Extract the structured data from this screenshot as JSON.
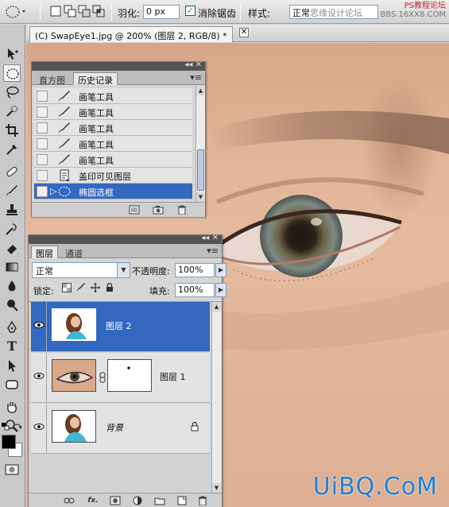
{
  "options_bar": {
    "feather_label": "羽化:",
    "feather_value": "0 px",
    "antialias_checked": "✓",
    "antialias_label": "消除锯齿",
    "style_label": "样式:",
    "style_value": "正常",
    "style_overlay": "思缘设计论坛",
    "watermark_line1": "PS教程论坛",
    "watermark_line2": "BBS.16XX8.COM"
  },
  "document": {
    "tab_title": "(C) SwapEye1.jpg @ 200% (图层 2, RGB/8) *",
    "close_glyph": "✕"
  },
  "history_panel": {
    "tabs": [
      "直方图",
      "历史记录"
    ],
    "menu_glyph": "▾≡",
    "title_controls": "◂◂ ✕",
    "items": [
      {
        "label": "画笔工具",
        "icon": "brush-icon",
        "selected": false
      },
      {
        "label": "画笔工具",
        "icon": "brush-icon",
        "selected": false
      },
      {
        "label": "画笔工具",
        "icon": "brush-icon",
        "selected": false
      },
      {
        "label": "画笔工具",
        "icon": "brush-icon",
        "selected": false
      },
      {
        "label": "画笔工具",
        "icon": "brush-icon",
        "selected": false
      },
      {
        "label": "盖印可见图层",
        "icon": "stamp-visible-icon",
        "selected": false
      },
      {
        "label": "椭圆选框",
        "icon": "elliptical-marquee-icon",
        "selected": true
      }
    ]
  },
  "layers_panel": {
    "tabs": [
      "图层",
      "通道"
    ],
    "menu_glyph": "▾≡",
    "title_controls": "◂◂ ✕",
    "blend_mode": "正常",
    "opacity_label": "不透明度:",
    "opacity_value": "100%",
    "lock_label": "锁定:",
    "fill_label": "填充:",
    "fill_value": "100%",
    "layers": [
      {
        "name": "图层 2",
        "visible": true,
        "selected": true,
        "thumb": "woman-photo"
      },
      {
        "name": "图层 1",
        "visible": true,
        "selected": false,
        "thumb": "eye-photo",
        "has_mask": true
      },
      {
        "name": "背景",
        "visible": true,
        "selected": false,
        "thumb": "woman-photo",
        "locked": true
      }
    ],
    "footer_buttons": [
      "link-icon",
      "fx-icon",
      "mask-icon",
      "adjustment-icon",
      "group-icon",
      "new-layer-icon",
      "trash-icon"
    ],
    "fx_label": "fx."
  },
  "watermark_bottom": "UiBQ.CoM",
  "colors": {
    "selection_blue": "#3368c0",
    "panel_bg": "#d6d6d6",
    "title_bar": "#535353",
    "watermark_blue": "#1f7fd6"
  }
}
